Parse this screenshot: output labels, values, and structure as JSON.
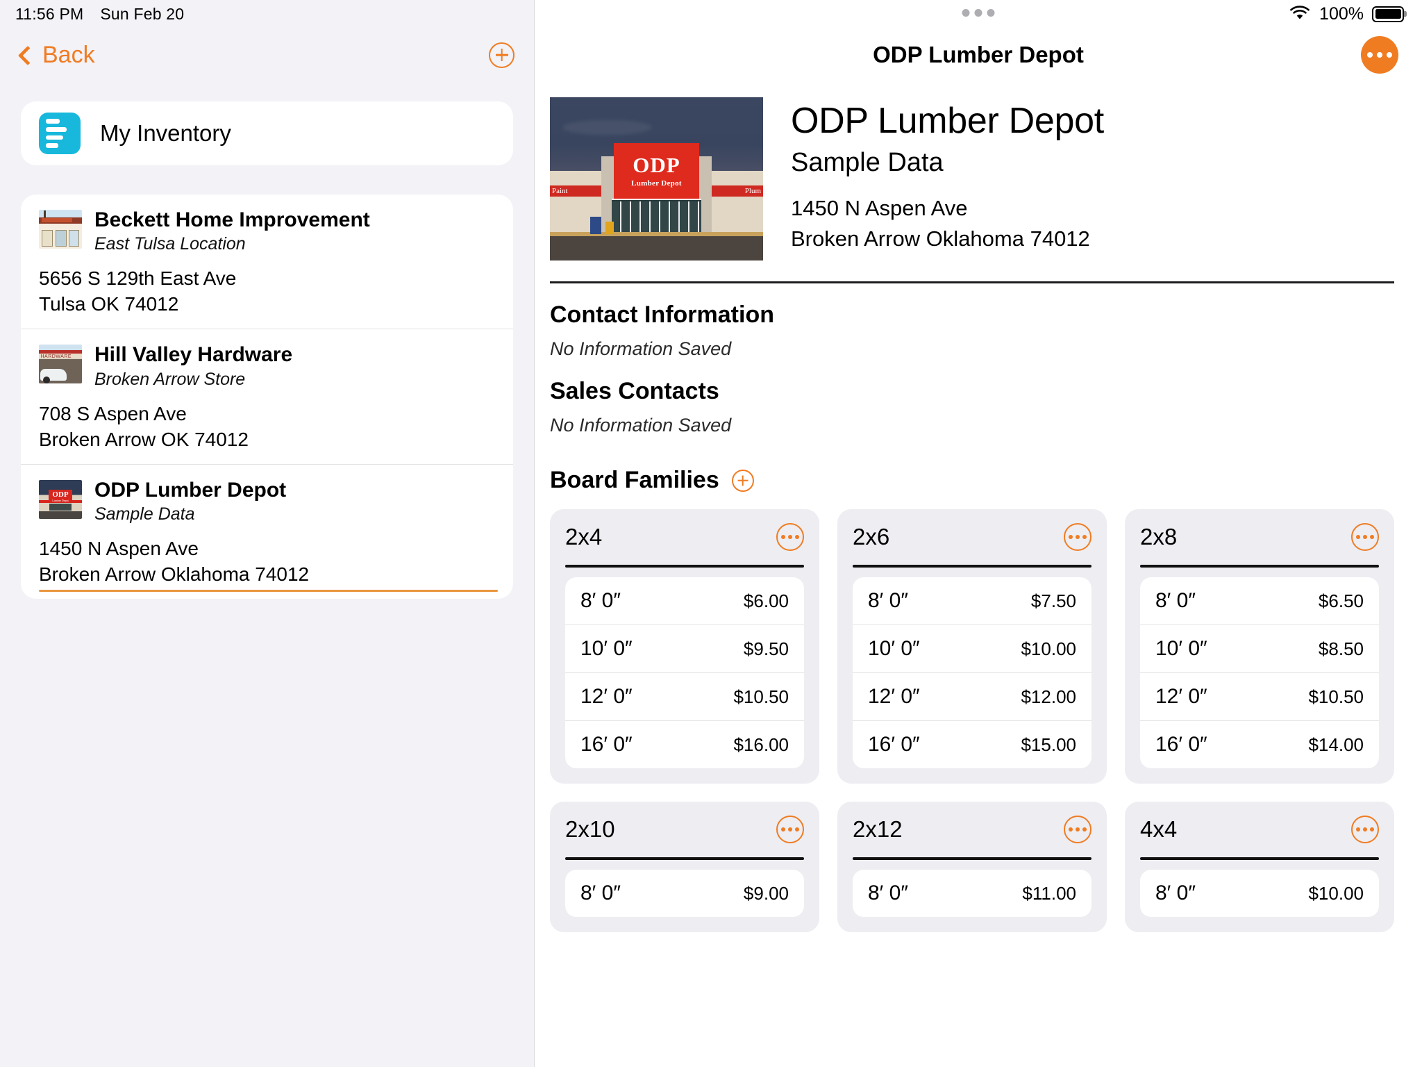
{
  "status_bar": {
    "time": "11:56 PM",
    "date": "Sun Feb 20",
    "battery_percent": "100%"
  },
  "sidebar": {
    "back_label": "Back",
    "add_button_label": "+",
    "inventory": {
      "label": "My Inventory",
      "icon": "inventory-icon"
    },
    "stores": [
      {
        "name": "Beckett Home Improvement",
        "subtitle": "East Tulsa Location",
        "address_line1": "5656 S 129th East Ave",
        "address_line2": "Tulsa OK 74012",
        "selected": false
      },
      {
        "name": "Hill Valley Hardware",
        "subtitle": "Broken Arrow Store",
        "address_line1": "708 S Aspen Ave",
        "address_line2": "Broken Arrow OK 74012",
        "selected": false
      },
      {
        "name": "ODP Lumber Depot",
        "subtitle": "Sample Data",
        "address_line1": "1450 N Aspen Ave",
        "address_line2": "Broken Arrow Oklahoma 74012",
        "selected": true
      }
    ]
  },
  "detail": {
    "nav_title": "ODP Lumber Depot",
    "hero": {
      "name": "ODP Lumber Depot",
      "subtitle": "Sample Data",
      "address_line1": "1450 N Aspen Ave",
      "address_line2": "Broken Arrow Oklahoma 74012",
      "photo": {
        "sign_brand": "ODP",
        "sign_tagline": "Lumber Depot",
        "left_banner": "Paint",
        "right_banner": "Plum"
      }
    },
    "sections": [
      {
        "title": "Contact Information",
        "empty_text": "No Information Saved"
      },
      {
        "title": "Sales Contacts",
        "empty_text": "No Information Saved"
      }
    ],
    "board_families": {
      "title": "Board Families",
      "add_button_label": "+",
      "cards": [
        {
          "title": "2x4",
          "rows": [
            {
              "length": "8′ 0″",
              "price": "$6.00"
            },
            {
              "length": "10′ 0″",
              "price": "$9.50"
            },
            {
              "length": "12′ 0″",
              "price": "$10.50"
            },
            {
              "length": "16′ 0″",
              "price": "$16.00"
            }
          ]
        },
        {
          "title": "2x6",
          "rows": [
            {
              "length": "8′ 0″",
              "price": "$7.50"
            },
            {
              "length": "10′ 0″",
              "price": "$10.00"
            },
            {
              "length": "12′ 0″",
              "price": "$12.00"
            },
            {
              "length": "16′ 0″",
              "price": "$15.00"
            }
          ]
        },
        {
          "title": "2x8",
          "rows": [
            {
              "length": "8′ 0″",
              "price": "$6.50"
            },
            {
              "length": "10′ 0″",
              "price": "$8.50"
            },
            {
              "length": "12′ 0″",
              "price": "$10.50"
            },
            {
              "length": "16′ 0″",
              "price": "$14.00"
            }
          ]
        },
        {
          "title": "2x10",
          "rows": [
            {
              "length": "8′ 0″",
              "price": "$9.00"
            }
          ]
        },
        {
          "title": "2x12",
          "rows": [
            {
              "length": "8′ 0″",
              "price": "$11.00"
            }
          ]
        },
        {
          "title": "4x4",
          "rows": [
            {
              "length": "8′ 0″",
              "price": "$10.00"
            }
          ]
        }
      ]
    }
  },
  "colors": {
    "accent_orange": "#f07c22",
    "inventory_cyan": "#17b8db",
    "sidebar_bg": "#f2f2f7",
    "card_bg": "#ededf2"
  }
}
